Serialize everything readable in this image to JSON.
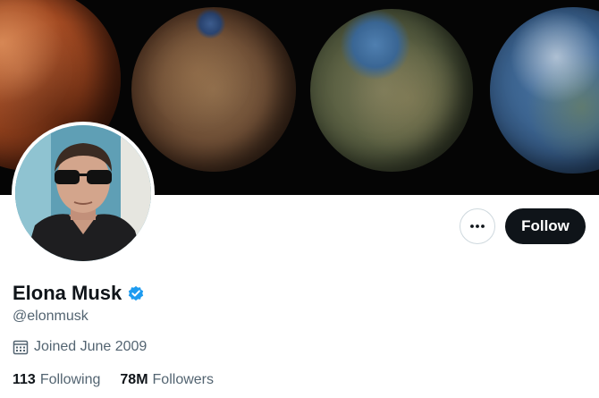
{
  "profile": {
    "display_name": "Elona Musk",
    "handle": "@elonmusk",
    "verified": true,
    "joined": "Joined June 2009"
  },
  "actions": {
    "more_icon": "more-horizontal-icon",
    "follow_label": "Follow"
  },
  "stats": {
    "following_count": "113",
    "following_label": "Following",
    "followers_count": "78M",
    "followers_label": "Followers"
  },
  "colors": {
    "follow_button_bg": "#0f1419",
    "verified_badge": "#1d9bf0",
    "secondary_text": "#536471",
    "primary_text": "#0f1419"
  }
}
